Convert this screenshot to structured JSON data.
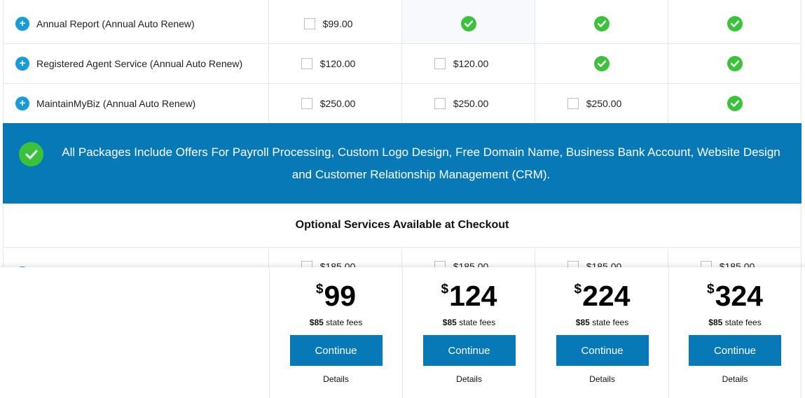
{
  "services": [
    {
      "name": "Annual Report (Annual Auto Renew)",
      "cells": [
        {
          "type": "option",
          "price": "$99.00"
        },
        {
          "type": "check"
        },
        {
          "type": "check"
        },
        {
          "type": "check"
        }
      ]
    },
    {
      "name": "Registered Agent Service (Annual Auto Renew)",
      "cells": [
        {
          "type": "option",
          "price": "$120.00"
        },
        {
          "type": "option",
          "price": "$120.00"
        },
        {
          "type": "check"
        },
        {
          "type": "check"
        }
      ]
    },
    {
      "name": "MaintainMyBiz (Annual Auto Renew)",
      "cells": [
        {
          "type": "option",
          "price": "$250.00"
        },
        {
          "type": "option",
          "price": "$250.00"
        },
        {
          "type": "option",
          "price": "$250.00"
        },
        {
          "type": "check"
        }
      ]
    }
  ],
  "banner": {
    "text": "All Packages Include Offers For Payroll Processing, Custom Logo Design, Free Domain Name, Business Bank Account, Website Design and Customer Relationship Management (CRM)."
  },
  "optional": {
    "heading": "Optional Services Available at Checkout",
    "first_row_prices": [
      "$185.00",
      "$185.00",
      "$185.00",
      "$185.00"
    ]
  },
  "plans": [
    {
      "currency": "$",
      "price": "99",
      "fees_amount": "$85",
      "fees_label": "state fees",
      "button": "Continue",
      "details": "Details"
    },
    {
      "currency": "$",
      "price": "124",
      "fees_amount": "$85",
      "fees_label": "state fees",
      "button": "Continue",
      "details": "Details"
    },
    {
      "currency": "$",
      "price": "224",
      "fees_amount": "$85",
      "fees_label": "state fees",
      "button": "Continue",
      "details": "Details"
    },
    {
      "currency": "$",
      "price": "324",
      "fees_amount": "$85",
      "fees_label": "state fees",
      "button": "Continue",
      "details": "Details"
    }
  ],
  "colors": {
    "primary_blue": "#0779b7",
    "check_green": "#3cc13b",
    "plus_blue": "#1a9ad9"
  }
}
